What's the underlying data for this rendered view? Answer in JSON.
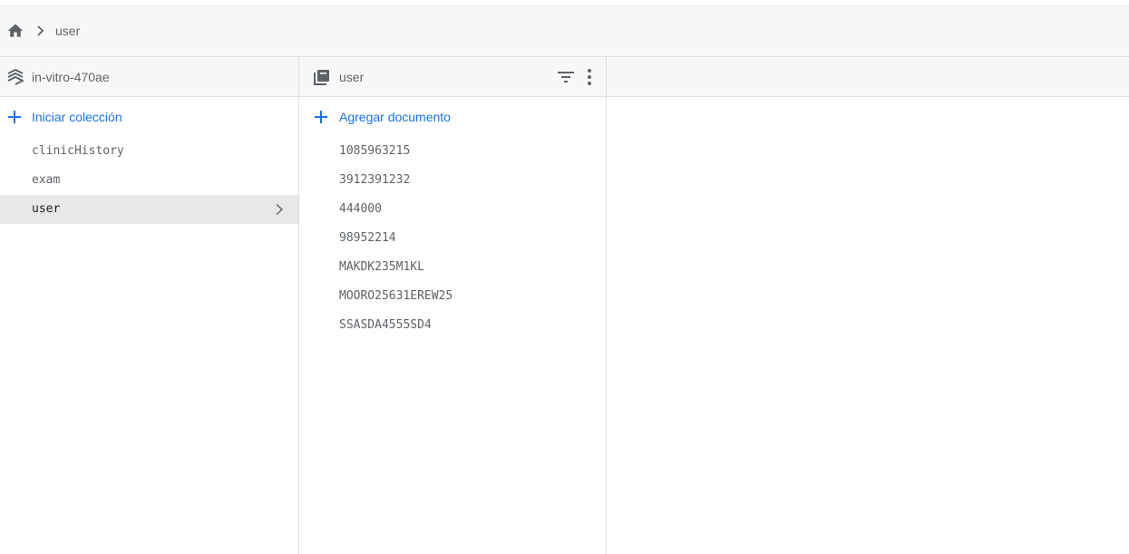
{
  "breadcrumb": {
    "home_icon": "home-icon",
    "items": [
      "user"
    ]
  },
  "project": {
    "name": "in-vitro-470ae",
    "icon": "firestore-project-icon",
    "add_label": "Iniciar colección",
    "collections": [
      {
        "label": "clinicHistory",
        "selected": false
      },
      {
        "label": "exam",
        "selected": false
      },
      {
        "label": "user",
        "selected": true
      }
    ]
  },
  "collection": {
    "name": "user",
    "icon": "collection-icon",
    "add_label": "Agregar documento",
    "documents": [
      "1085963215",
      "3912391232",
      "444000",
      "98952214",
      "MAKDK235M1KL",
      "MOORO25631EREW25",
      "SSASDA4555SD4"
    ]
  },
  "colors": {
    "accent": "#1a73e8",
    "selected_bg": "#e8e8e8",
    "header_bg": "#f8f8f8",
    "text": "#5f6368"
  }
}
